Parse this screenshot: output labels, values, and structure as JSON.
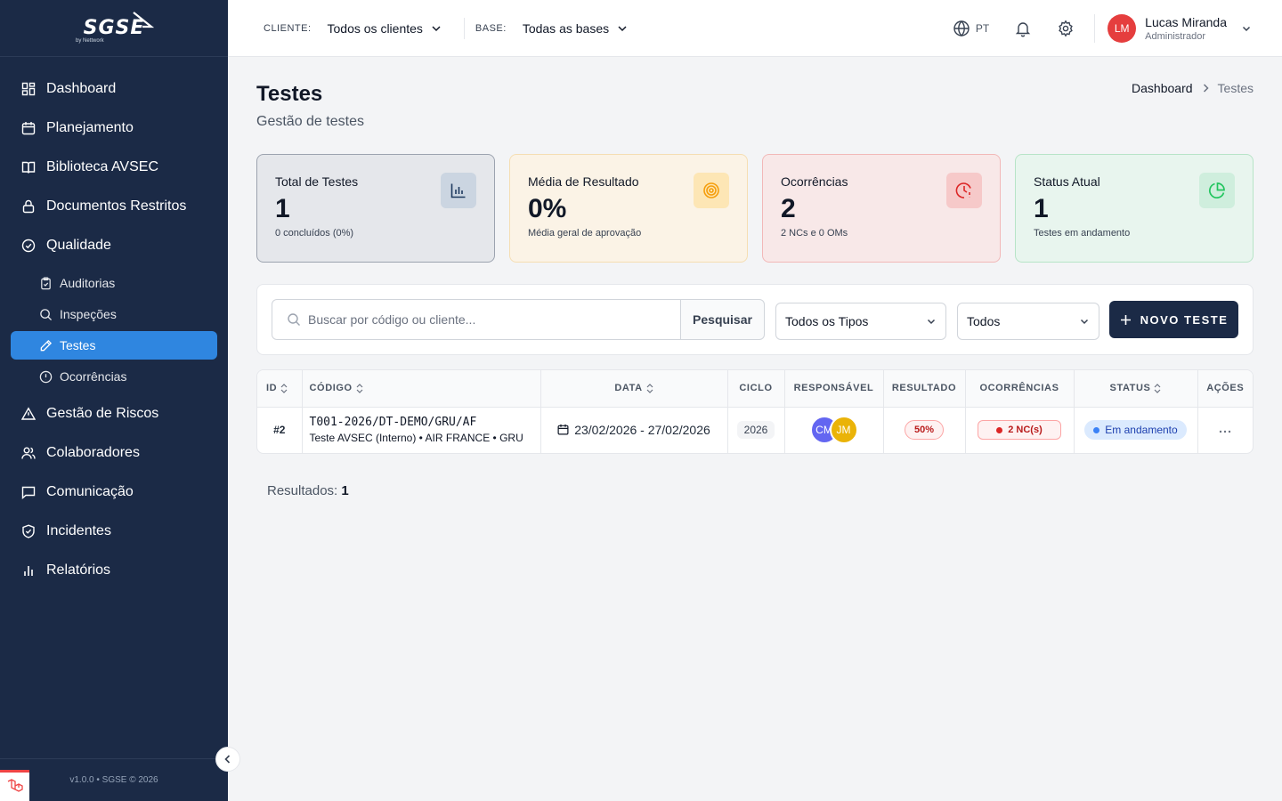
{
  "brand": {
    "logo": "SGSE",
    "sub": "by Nettwork"
  },
  "sidebar": {
    "items": [
      {
        "label": "Dashboard"
      },
      {
        "label": "Planejamento"
      },
      {
        "label": "Biblioteca AVSEC"
      },
      {
        "label": "Documentos Restritos"
      },
      {
        "label": "Qualidade"
      },
      {
        "label": "Auditorias"
      },
      {
        "label": "Inspeções"
      },
      {
        "label": "Testes"
      },
      {
        "label": "Ocorrências"
      },
      {
        "label": "Gestão de Riscos"
      },
      {
        "label": "Colaboradores"
      },
      {
        "label": "Comunicação"
      },
      {
        "label": "Incidentes"
      },
      {
        "label": "Relatórios"
      }
    ],
    "footer": "v1.0.0 • SGSE © 2026"
  },
  "topbar": {
    "client_label": "CLIENTE:",
    "client_value": "Todos os clientes",
    "base_label": "BASE:",
    "base_value": "Todas as bases",
    "lang": "PT",
    "user": {
      "initials": "LM",
      "name": "Lucas Miranda",
      "role": "Administrador"
    }
  },
  "page": {
    "title": "Testes",
    "subtitle": "Gestão de testes",
    "breadcrumb": [
      "Dashboard",
      "Testes"
    ]
  },
  "cards": [
    {
      "title": "Total de Testes",
      "value": "1",
      "sub": "0 concluídos (0%)",
      "icon": "bar-chart-icon",
      "bg": "#e5e7eb",
      "border": "#9ca3af",
      "icon_bg": "#cbd5e1",
      "icon_color": "#1e3a5f"
    },
    {
      "title": "Média de Resultado",
      "value": "0%",
      "sub": "Média geral de aprovação",
      "icon": "target-icon",
      "bg": "#fbf3e6",
      "border": "#f5deb3",
      "icon_bg": "#fde6b5",
      "icon_color": "#f59e0b"
    },
    {
      "title": "Ocorrências",
      "value": "2",
      "sub": "2 NCs e 0 OMs",
      "icon": "alert-clock-icon",
      "bg": "#f8e8e8",
      "border": "#f2b8b8",
      "icon_bg": "#f6c9c9",
      "icon_color": "#dc2626"
    },
    {
      "title": "Status Atual",
      "value": "1",
      "sub": "Testes em andamento",
      "icon": "pie-chart-icon",
      "bg": "#e8f5ee",
      "border": "#b7e4c7",
      "icon_bg": "#cfeedd",
      "icon_color": "#22c55e"
    }
  ],
  "search": {
    "placeholder": "Buscar por código ou cliente...",
    "button": "Pesquisar",
    "type_filter": "Todos os Tipos",
    "status_filter": "Todos",
    "new_button": "NOVO TESTE"
  },
  "table": {
    "headers": [
      "ID",
      "CÓDIGO",
      "DATA",
      "CICLO",
      "RESPONSÁVEL",
      "RESULTADO",
      "OCORRÊNCIAS",
      "STATUS",
      "AÇÕES"
    ],
    "rows": [
      {
        "id": "#2",
        "code": "T001-2026/DT-DEMO/GRU/AF",
        "desc": "Teste AVSEC (Interno) • AIR FRANCE • GRU",
        "date": "23/02/2026 - 27/02/2026",
        "cycle": "2026",
        "resp": [
          "CM",
          "JM"
        ],
        "result": "50%",
        "occ": "2 NC(s)",
        "status": "Em andamento"
      }
    ]
  },
  "results": {
    "label": "Resultados:",
    "count": "1"
  }
}
